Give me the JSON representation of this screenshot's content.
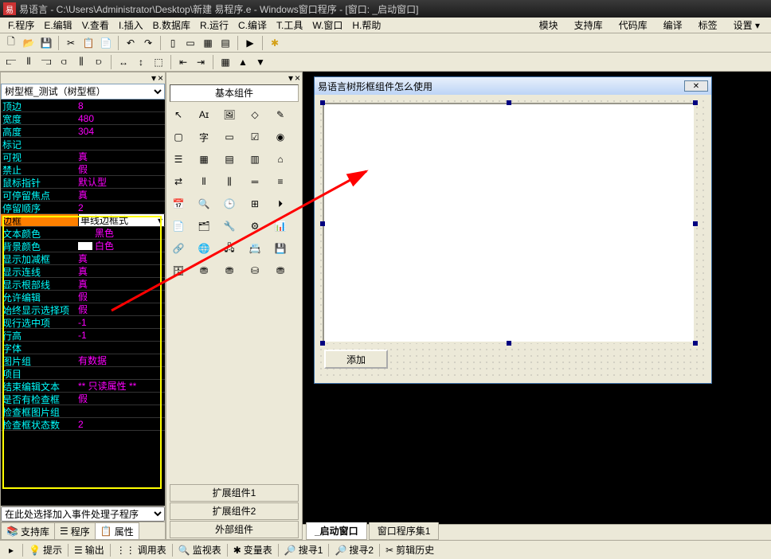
{
  "title": "易语言 - C:\\Users\\Administrator\\Desktop\\新建 易程序.e - Windows窗口程序 - [窗口: _启动窗口]",
  "menus": [
    "F.程序",
    "E.编辑",
    "V.查看",
    "I.插入",
    "B.数据库",
    "R.运行",
    "C.编译",
    "T.工具",
    "W.窗口",
    "H.帮助"
  ],
  "right_menus": [
    "模块",
    "支持库",
    "代码库",
    "编译",
    "标签",
    "设置 ▾"
  ],
  "left": {
    "combo": "树型框_测试（树型框）",
    "event_combo": "在此处选择加入事件处理子程序",
    "tabs": [
      "支持库",
      "程序",
      "属性"
    ],
    "props": [
      {
        "n": "顶边",
        "v": "8"
      },
      {
        "n": "宽度",
        "v": "480"
      },
      {
        "n": "高度",
        "v": "304"
      },
      {
        "n": "标记",
        "v": ""
      },
      {
        "n": "可视",
        "v": "真"
      },
      {
        "n": "禁止",
        "v": "假"
      },
      {
        "n": "鼠标指针",
        "v": "默认型"
      },
      {
        "n": "可停留焦点",
        "v": "真"
      },
      {
        "n": "停留顺序",
        "v": "2"
      },
      {
        "n": "边框",
        "v": "单线边框式",
        "sel": true
      },
      {
        "n": "文本颜色",
        "v": "黑色",
        "swatch": "#000000"
      },
      {
        "n": "背景颜色",
        "v": "白色",
        "swatch": "#ffffff"
      },
      {
        "n": "显示加减框",
        "v": "真"
      },
      {
        "n": "显示连线",
        "v": "真"
      },
      {
        "n": "显示根部线",
        "v": "真"
      },
      {
        "n": "允许编辑",
        "v": "假"
      },
      {
        "n": "始终显示选择项",
        "v": "假"
      },
      {
        "n": "现行选中项",
        "v": "-1"
      },
      {
        "n": "行高",
        "v": "-1"
      },
      {
        "n": "字体",
        "v": ""
      },
      {
        "n": "图片组",
        "v": "有数据"
      },
      {
        "n": "项目",
        "v": ""
      },
      {
        "n": "结束编辑文本",
        "v": "** 只读属性 **"
      },
      {
        "n": "是否有检查框",
        "v": "假"
      },
      {
        "n": "检查框图片组",
        "v": ""
      },
      {
        "n": "检查框状态数",
        "v": "2"
      }
    ]
  },
  "mid": {
    "cats": [
      "基本组件",
      "扩展组件1",
      "扩展组件2",
      "外部组件"
    ],
    "items": [
      "↖",
      "Aɪ",
      "🖼",
      "◇",
      "✎",
      "▢",
      "字",
      "▭",
      "☑",
      "◉",
      "☰",
      "▦",
      "▤",
      "▥",
      "⌂",
      "⇄",
      "⫴",
      "⫼",
      "═",
      "≡",
      "📅",
      "🔍",
      "🕒",
      "⊞",
      "⏵",
      "📄",
      "🗂",
      "🔧",
      "⚙",
      "📊",
      "🔗",
      "🌐",
      "🖧",
      "📇",
      "💾",
      "🗄",
      "⛃",
      "⛃",
      "⛁",
      "⛃"
    ]
  },
  "design": {
    "win_title": "易语言树形框组件怎么使用",
    "add_btn": "添加"
  },
  "bottom_tabs": [
    "_启动窗口",
    "窗口程序集1"
  ],
  "status_items": [
    "提示",
    "输出",
    "调用表",
    "监视表",
    "变量表",
    "搜寻1",
    "搜寻2",
    "剪辑历史"
  ]
}
